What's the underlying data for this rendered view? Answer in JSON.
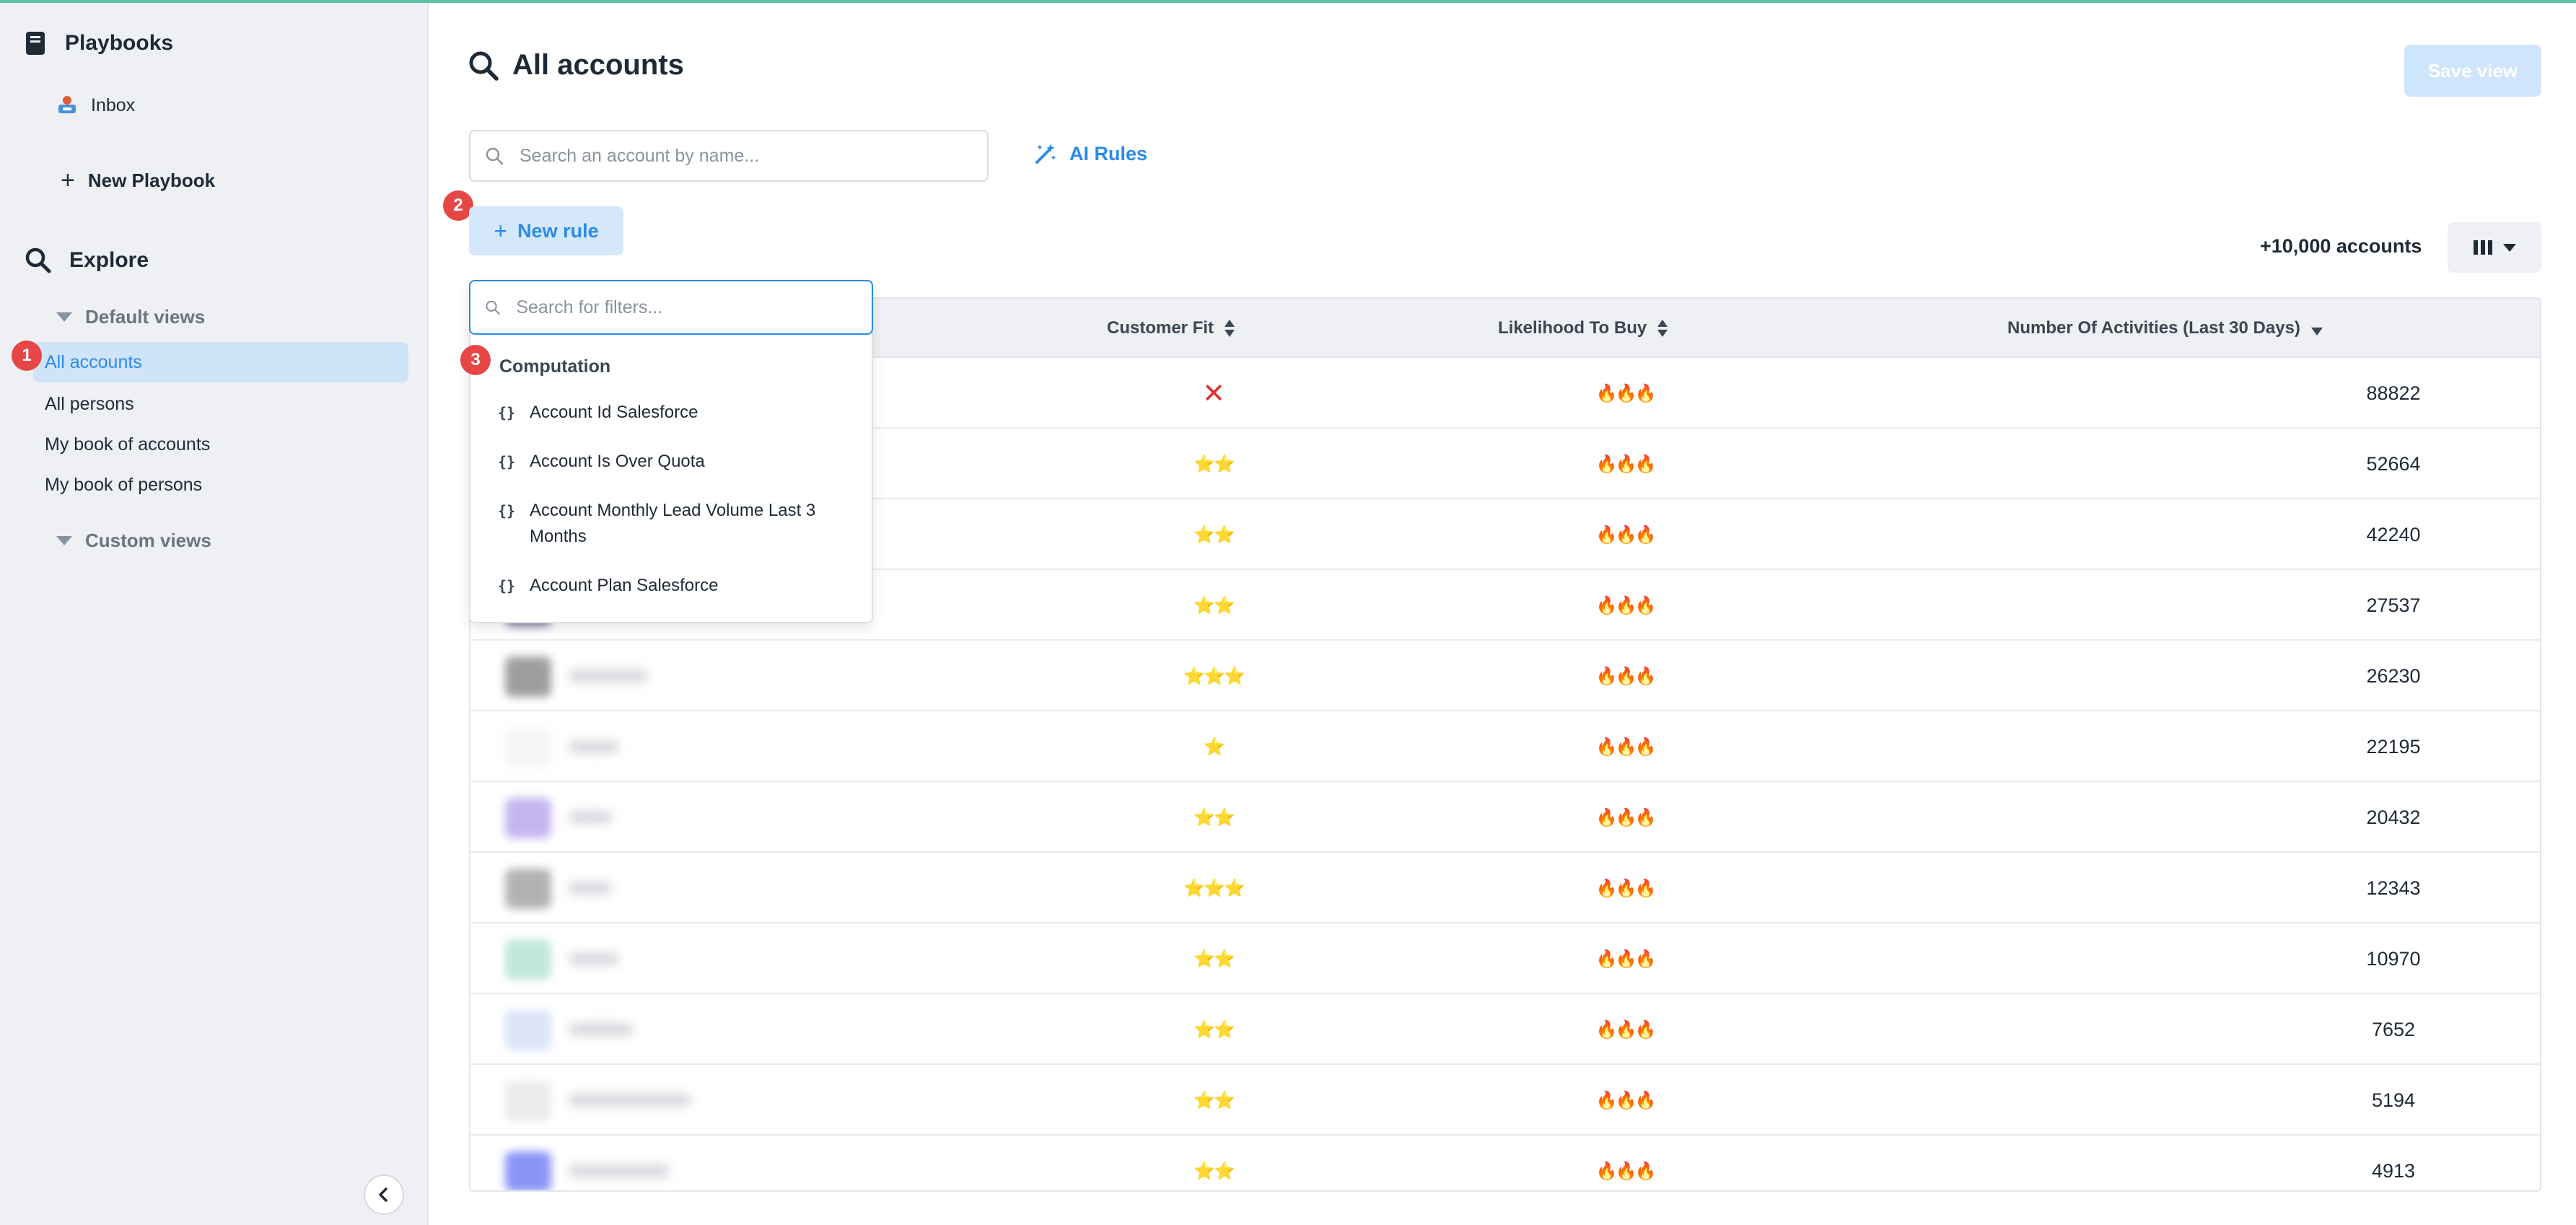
{
  "sidebar": {
    "playbooks_title": "Playbooks",
    "inbox_label": "Inbox",
    "new_playbook_label": "New Playbook",
    "explore_title": "Explore",
    "default_views_label": "Default views",
    "default_views": [
      "All accounts",
      "All persons",
      "My book of accounts",
      "My book of persons"
    ],
    "custom_views_label": "Custom views",
    "active_view": "All accounts"
  },
  "steps": [
    "1",
    "2",
    "3"
  ],
  "header": {
    "title": "All accounts",
    "save_view_label": "Save view"
  },
  "toolbar": {
    "search_placeholder": "Search an account by name...",
    "ai_rules_label": "AI Rules",
    "new_rule_label": "New rule",
    "accounts_count": "+10,000 accounts"
  },
  "filter_dropdown": {
    "search_placeholder": "Search for filters...",
    "group_label": "Computation",
    "items": [
      "Account Id Salesforce",
      "Account Is Over Quota",
      "Account Monthly Lead Volume Last 3 Months",
      "Account Plan Salesforce"
    ]
  },
  "table": {
    "columns": [
      "Customer Fit",
      "Likelihood To Buy",
      "Number Of Activities (Last 30 Days)"
    ],
    "rows": [
      {
        "fit": "✕",
        "likelihood": "🔥🔥🔥",
        "activities": "88822",
        "logo_color": "#ffffff"
      },
      {
        "fit": "⭐⭐",
        "likelihood": "🔥🔥🔥",
        "activities": "52664",
        "logo_color": "#ffffff"
      },
      {
        "fit": "⭐⭐",
        "likelihood": "🔥🔥🔥",
        "activities": "42240",
        "logo_color": "#ffffff"
      },
      {
        "fit": "⭐⭐",
        "likelihood": "🔥🔥🔥",
        "activities": "27537",
        "logo_color": "#3a2f6e"
      },
      {
        "fit": "⭐⭐⭐",
        "likelihood": "🔥🔥🔥",
        "activities": "26230",
        "logo_color": "#6b6b6b"
      },
      {
        "fit": "⭐",
        "likelihood": "🔥🔥🔥",
        "activities": "22195",
        "logo_color": "#f2f2f2"
      },
      {
        "fit": "⭐⭐",
        "likelihood": "🔥🔥🔥",
        "activities": "20432",
        "logo_color": "#a58ee6"
      },
      {
        "fit": "⭐⭐⭐",
        "likelihood": "🔥🔥🔥",
        "activities": "12343",
        "logo_color": "#8a8a8a"
      },
      {
        "fit": "⭐⭐",
        "likelihood": "🔥🔥🔥",
        "activities": "10970",
        "logo_color": "#9fdcc4"
      },
      {
        "fit": "⭐⭐",
        "likelihood": "🔥🔥🔥",
        "activities": "7652",
        "logo_color": "#c9d6f4"
      },
      {
        "fit": "⭐⭐",
        "likelihood": "🔥🔥🔥",
        "activities": "5194",
        "logo_color": "#e1e1e1"
      },
      {
        "fit": "⭐⭐",
        "likelihood": "🔥🔥🔥",
        "activities": "4913",
        "logo_color": "#4b5cf0"
      }
    ]
  },
  "colors": {
    "accent": "#2b8be6",
    "badge": "#e74646",
    "sidebar_bg": "#eef0f3"
  }
}
